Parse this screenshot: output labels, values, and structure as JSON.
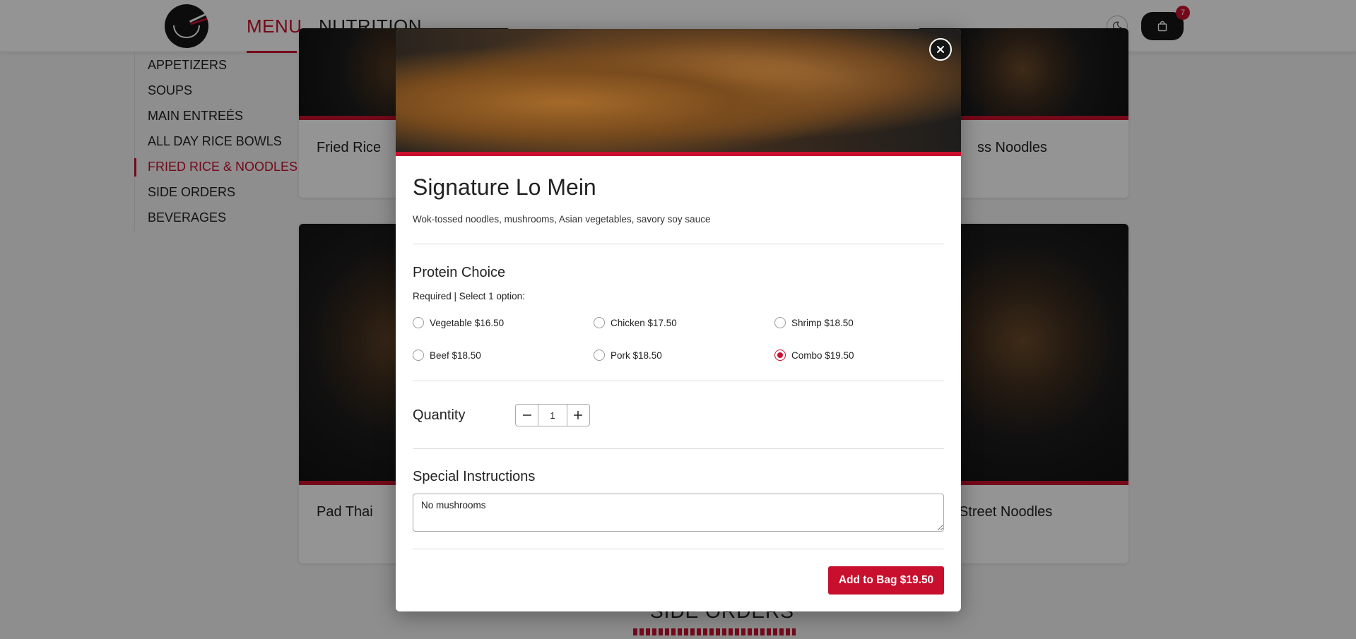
{
  "header": {
    "nav": [
      {
        "label": "MENU",
        "active": true
      },
      {
        "label": "NUTRITION",
        "active": false
      }
    ],
    "bag_count": "7",
    "icons": {
      "logo": "bowl-chopsticks-logo",
      "theme": "moon-icon",
      "bag": "shopping-bag-icon"
    }
  },
  "sidebar": {
    "items": [
      {
        "label": "APPETIZERS"
      },
      {
        "label": "SOUPS"
      },
      {
        "label": "MAIN ENTREÉS"
      },
      {
        "label": "ALL DAY RICE BOWLS"
      },
      {
        "label": "FRIED RICE & NOODLES",
        "active": true
      },
      {
        "label": "SIDE ORDERS"
      },
      {
        "label": "BEVERAGES"
      }
    ]
  },
  "cards": [
    {
      "title": "Fried Rice"
    },
    {
      "title": "ss Noodles"
    },
    {
      "title": "Pad Thai"
    },
    {
      "title": "Street Noodles"
    }
  ],
  "section": {
    "title": "SIDE ORDERS"
  },
  "modal": {
    "title": "Signature Lo Mein",
    "description": "Wok-tossed noodles, mushrooms, Asian vegetables, savory soy sauce",
    "protein": {
      "heading": "Protein Choice",
      "note": "Required | Select 1 option:",
      "options": [
        {
          "label": "Vegetable $16.50",
          "checked": false
        },
        {
          "label": "Chicken $17.50",
          "checked": false
        },
        {
          "label": "Shrimp $18.50",
          "checked": false
        },
        {
          "label": "Beef $18.50",
          "checked": false
        },
        {
          "label": "Pork $18.50",
          "checked": false
        },
        {
          "label": "Combo $19.50",
          "checked": true
        }
      ]
    },
    "quantity": {
      "label": "Quantity",
      "value": "1"
    },
    "instructions": {
      "heading": "Special Instructions",
      "value": "No mushrooms"
    },
    "add_button": "Add to Bag $19.50"
  },
  "colors": {
    "accent": "#c8102e",
    "dark": "#151515"
  }
}
